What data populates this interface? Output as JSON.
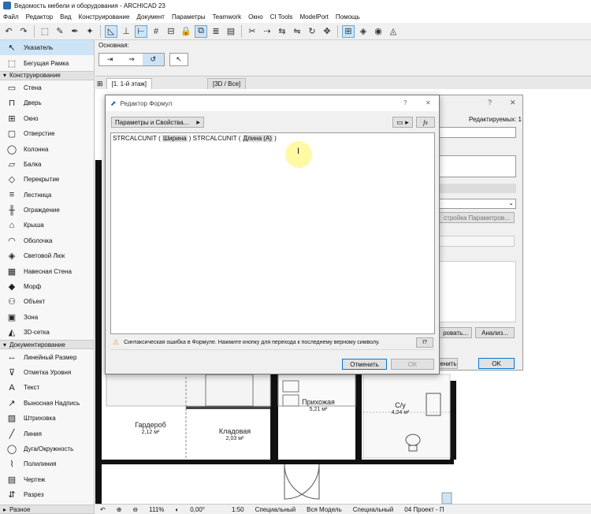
{
  "window": {
    "title": "Ведомость мебели и оборудования - ARCHICAD 23"
  },
  "menu": [
    "Файл",
    "Редактор",
    "Вид",
    "Конструирование",
    "Документ",
    "Параметры",
    "Teamwork",
    "Окно",
    "CI Tools",
    "ModelPort",
    "Помощь"
  ],
  "toolbox": {
    "top_items": [
      {
        "icon": "arrow-pointer-icon",
        "label": "Указатель",
        "selected": true
      },
      {
        "icon": "marquee-icon",
        "label": "Бегущая Рамка"
      }
    ],
    "section_design": "Конструирование",
    "design_items": [
      {
        "icon": "wall-icon",
        "label": "Стена"
      },
      {
        "icon": "door-icon",
        "label": "Дверь"
      },
      {
        "icon": "window-icon",
        "label": "Окно"
      },
      {
        "icon": "opening-icon",
        "label": "Отверстие"
      },
      {
        "icon": "column-icon",
        "label": "Колонна"
      },
      {
        "icon": "beam-icon",
        "label": "Балка"
      },
      {
        "icon": "slab-icon",
        "label": "Перекрытие"
      },
      {
        "icon": "stair-icon",
        "label": "Лестница"
      },
      {
        "icon": "railing-icon",
        "label": "Ограждение"
      },
      {
        "icon": "roof-icon",
        "label": "Крыша"
      },
      {
        "icon": "shell-icon",
        "label": "Оболочка"
      },
      {
        "icon": "skylight-icon",
        "label": "Световой Люк"
      },
      {
        "icon": "curtain-wall-icon",
        "label": "Навесная Стена"
      },
      {
        "icon": "morph-icon",
        "label": "Морф"
      },
      {
        "icon": "object-icon",
        "label": "Объект"
      },
      {
        "icon": "zone-icon",
        "label": "Зона"
      },
      {
        "icon": "mesh-icon",
        "label": "3D-сетка"
      }
    ],
    "section_docs": "Документирование",
    "doc_items": [
      {
        "icon": "dimension-icon",
        "label": "Линейный Размер"
      },
      {
        "icon": "level-icon",
        "label": "Отметка Уровня"
      },
      {
        "icon": "text-icon",
        "label": "Текст"
      },
      {
        "icon": "label-icon",
        "label": "Выносная Надпись"
      },
      {
        "icon": "fill-icon",
        "label": "Штриховка"
      },
      {
        "icon": "line-icon",
        "label": "Линия"
      },
      {
        "icon": "arc-icon",
        "label": "Дуга/Окружность"
      },
      {
        "icon": "polyline-icon",
        "label": "Полилиния"
      },
      {
        "icon": "drawing-icon",
        "label": "Чертеж"
      },
      {
        "icon": "section-icon",
        "label": "Разрез"
      }
    ],
    "bottom": "Разное"
  },
  "infobox": {
    "label": "Основная:"
  },
  "tabs": [
    {
      "label": "[1. 1-й этаж]",
      "active": true
    },
    {
      "label": "[3D / Все]",
      "active": false
    }
  ],
  "formula_dialog": {
    "title": "Редактор Формул",
    "help": "?",
    "close": "✕",
    "params_button": "Параметры и Свойства...",
    "fx_button": "fx",
    "formula": {
      "part1": "STRCALCUNIT ( ",
      "arg1": "Ширина",
      "part2": " ) STRCALCUNIT ( ",
      "arg2": "Длина (А)",
      "part3": " )"
    },
    "error_message": "Синтаксическая ошибка в Формуле. Нажмите кнопку для перехода к последнему верному символу.",
    "cancel": "Отменить",
    "ok": "OK"
  },
  "bg_dialog": {
    "help": "?",
    "close": "✕",
    "editable_label": "Редактируемых: 1",
    "settings_button": "стройка Параметров...",
    "button_a": "ровать...",
    "analysis_button": "Анализ...",
    "apply": "енить",
    "ok": "OK"
  },
  "plan": {
    "rooms": [
      {
        "name": "Гардероб",
        "area": "2,12 м²"
      },
      {
        "name": "Кладовая",
        "area": "2,03 м²"
      },
      {
        "name": "Прихожая",
        "area": "5,21 м²"
      },
      {
        "name": "С/у",
        "area": "4,24 м²"
      }
    ]
  },
  "status": {
    "zoom": "111%",
    "angle": "0,00°",
    "scale": "1:50",
    "layer": "Специальный",
    "model": "Вся Модель",
    "layer2": "Специальный",
    "project": "04 Проект - П"
  },
  "colors": {
    "selection": "#cde4f7",
    "accent": "#0078d7",
    "cursor_highlight": "#fff89a"
  }
}
